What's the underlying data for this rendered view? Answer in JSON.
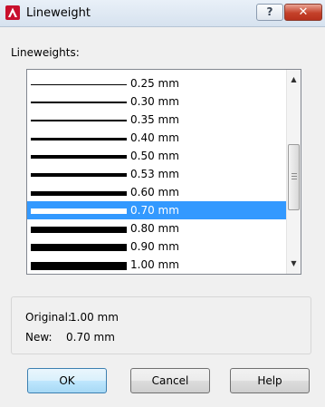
{
  "window": {
    "title": "Lineweight",
    "help_label": "?",
    "close_label": "✕"
  },
  "list_label": "Lineweights:",
  "lineweights": [
    {
      "label": "0.25 mm",
      "thickness": 1,
      "selected": false
    },
    {
      "label": "0.30 mm",
      "thickness": 2,
      "selected": false
    },
    {
      "label": "0.35 mm",
      "thickness": 2,
      "selected": false
    },
    {
      "label": "0.40 mm",
      "thickness": 3,
      "selected": false
    },
    {
      "label": "0.50 mm",
      "thickness": 4,
      "selected": false
    },
    {
      "label": "0.53 mm",
      "thickness": 4,
      "selected": false
    },
    {
      "label": "0.60 mm",
      "thickness": 5,
      "selected": false
    },
    {
      "label": "0.70 mm",
      "thickness": 6,
      "selected": true
    },
    {
      "label": "0.80 mm",
      "thickness": 7,
      "selected": false
    },
    {
      "label": "0.90 mm",
      "thickness": 8,
      "selected": false
    },
    {
      "label": "1.00 mm",
      "thickness": 9,
      "selected": false
    }
  ],
  "info": {
    "original_label": "Original:",
    "original_value": "1.00 mm",
    "new_label": "New:",
    "new_value": "0.70 mm"
  },
  "buttons": {
    "ok": "OK",
    "cancel": "Cancel",
    "help": "Help"
  },
  "icons": {
    "app": "autocad-icon",
    "scroll_up": "up-arrow-icon",
    "scroll_down": "down-arrow-icon"
  },
  "colors": {
    "selection": "#3399ff",
    "titlebar": "#dbe6f2",
    "close_button": "#c4412a"
  }
}
